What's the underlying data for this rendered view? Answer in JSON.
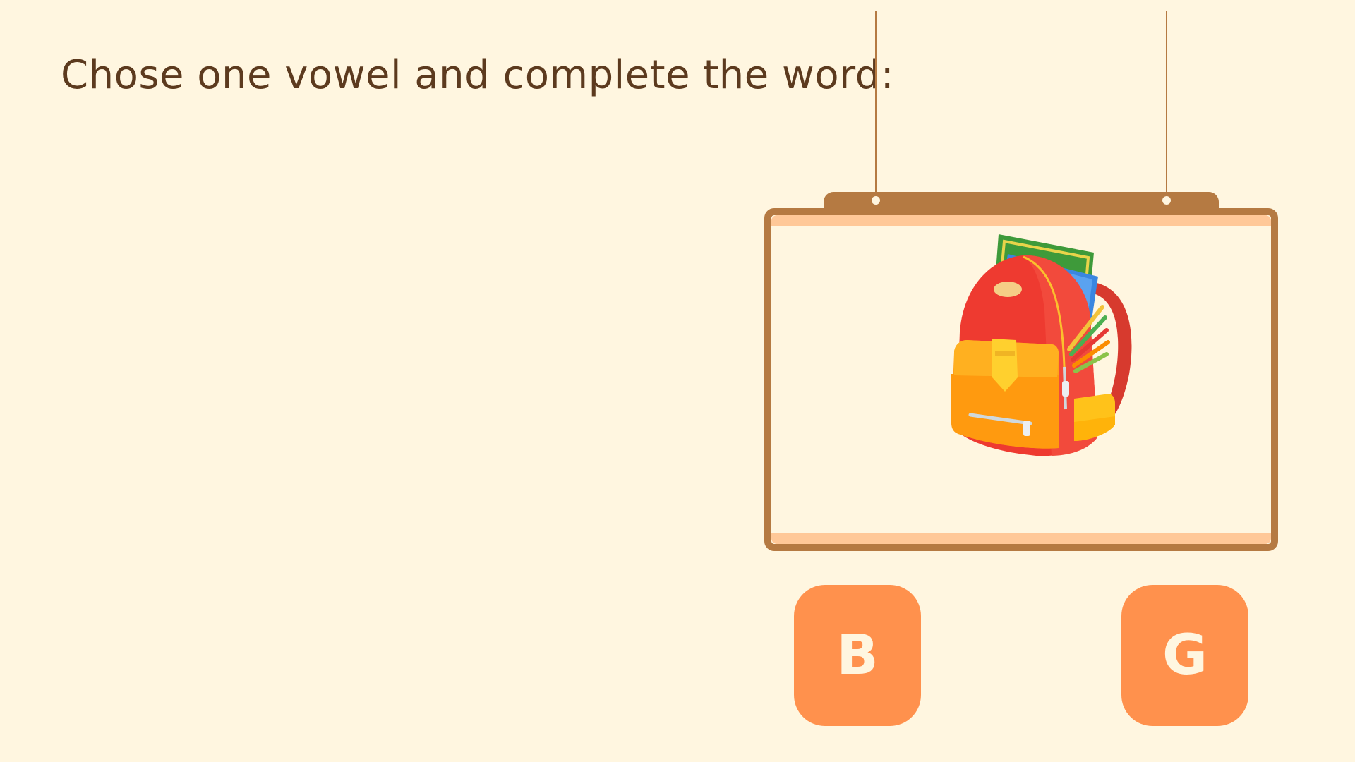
{
  "instruction": "Chose one vowel and complete the word:",
  "picture": {
    "icon": "backpack-icon"
  },
  "options": [
    {
      "label": "B"
    },
    {
      "label": "G"
    }
  ],
  "colors": {
    "background": "#FFF6E0",
    "text": "#5C3A1E",
    "frame": "#B57A42",
    "frame_inner": "#FFC898",
    "button": "#FF914D",
    "button_text": "#FFF6E0"
  }
}
